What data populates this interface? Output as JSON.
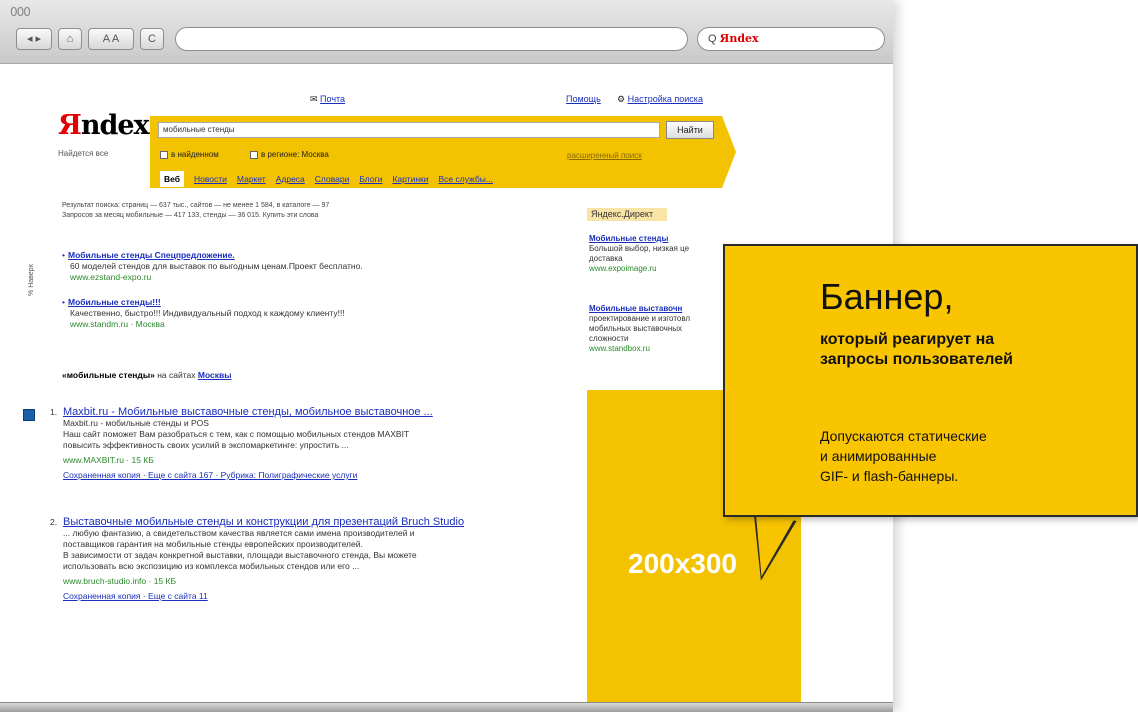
{
  "browser": {
    "traffic_lights": "000",
    "search_placeholder": "Q",
    "search_brand": "Яndex",
    "toolbar_buttons": [
      "◂ ▸",
      "⌂",
      "A A",
      "C"
    ]
  },
  "page": {
    "top_links": {
      "mail": "Почта",
      "help": "Помощь",
      "settings": "Настройка поиска"
    },
    "logo": {
      "first": "Я",
      "rest": "ndex",
      "tagline": "Найдется все"
    },
    "search": {
      "query": "мобильные стенды",
      "button": "Найти",
      "check_found": "в найденном",
      "check_region": "в регионе: Москва",
      "advanced": "расширенный поиск"
    },
    "services": [
      "Веб",
      "Новости",
      "Маркет",
      "Адреса",
      "Словари",
      "Блоги",
      "Картинки",
      "Все службы..."
    ],
    "stats": [
      "Результат поиска: страниц — 637 тыс., сайтов — не менее 1 584, в каталоге — 97",
      "Запросов за месяц мобильные — 417 133, стенды — 36 015. Купить эти слова"
    ],
    "side_label": "% Наверх",
    "ads": [
      {
        "title": "Мобильные стенды Спецпредложение.",
        "desc": "60 моделей стендов для выставок по выгодным ценам.Проект бесплатно.",
        "url": "www.ezstand-expo.ru"
      },
      {
        "title": "Мобильные стенды!!!",
        "desc": "Качественно, быстро!!! Индивидуальный подход к каждому клиенту!!!",
        "url": "www.standm.ru · Москва"
      }
    ],
    "moscow_line": {
      "query": "«мобильные стенды»",
      "middle": "на сайтах",
      "city": "Москвы"
    },
    "results": [
      {
        "num": "1.",
        "title": "Maxbit.ru - Мобильные выставочные стенды, мобильное выставочное ...",
        "lines": [
          "Maxbit.ru - мобильные стенды и POS",
          "Наш сайт поможет Вам разобраться с тем, как с помощью мобильных стендов MAXBIT",
          "повысить эффективность своих усилий в экспомаркетинге: упростить ..."
        ],
        "url": "www.MAXBIT.ru · 15 КБ",
        "sub": "Сохраненная копия · Еще с сайта 167 · Рубрика: Полиграфические услуги"
      },
      {
        "num": "2.",
        "title": "Выставочные мобильные стенды и конструкции для презентаций Bruch Studio",
        "lines": [
          "... любую фантазию, а свидетельством качества является сами имена производителей и",
          "поставщиков гарантия на мобильные стенды европейских производителей.",
          "В зависимости от задач конкретной выставки, площади выставочного стенда, Вы можете",
          "использовать всю экспозицию из комплекса мобильных стендов или его ..."
        ],
        "url": "www.bruch-studio.info · 15 КБ",
        "sub": "Сохраненная копия · Еще с сайта 11"
      }
    ],
    "direct": {
      "header": "Яндекс.Директ",
      "items": [
        {
          "title": "Мобильные стенды",
          "lines": [
            "Большой выбор, низкая це",
            "доставка"
          ],
          "url": "www.expoimage.ru"
        },
        {
          "title": "Мобильные выставочн",
          "lines": [
            "проектирование и изготовл",
            "мобильных выставочных",
            "сложности"
          ],
          "url": "www.standbox.ru"
        }
      ]
    },
    "banner_size": "200x300"
  },
  "callout": {
    "title": "Баннер,",
    "sub_1": "который реагирует на",
    "sub_2": "запросы пользователей",
    "body_1": "Допускаются статические",
    "body_2": "и анимированные",
    "body_3": "GIF- и  flash-баннеры."
  },
  "colors": {
    "yandex_yellow": "#f3c200",
    "callout_yellow": "#f9c500",
    "link_blue": "#1a2fbd",
    "url_green": "#2a8a2a",
    "logo_red": "#e30000"
  }
}
